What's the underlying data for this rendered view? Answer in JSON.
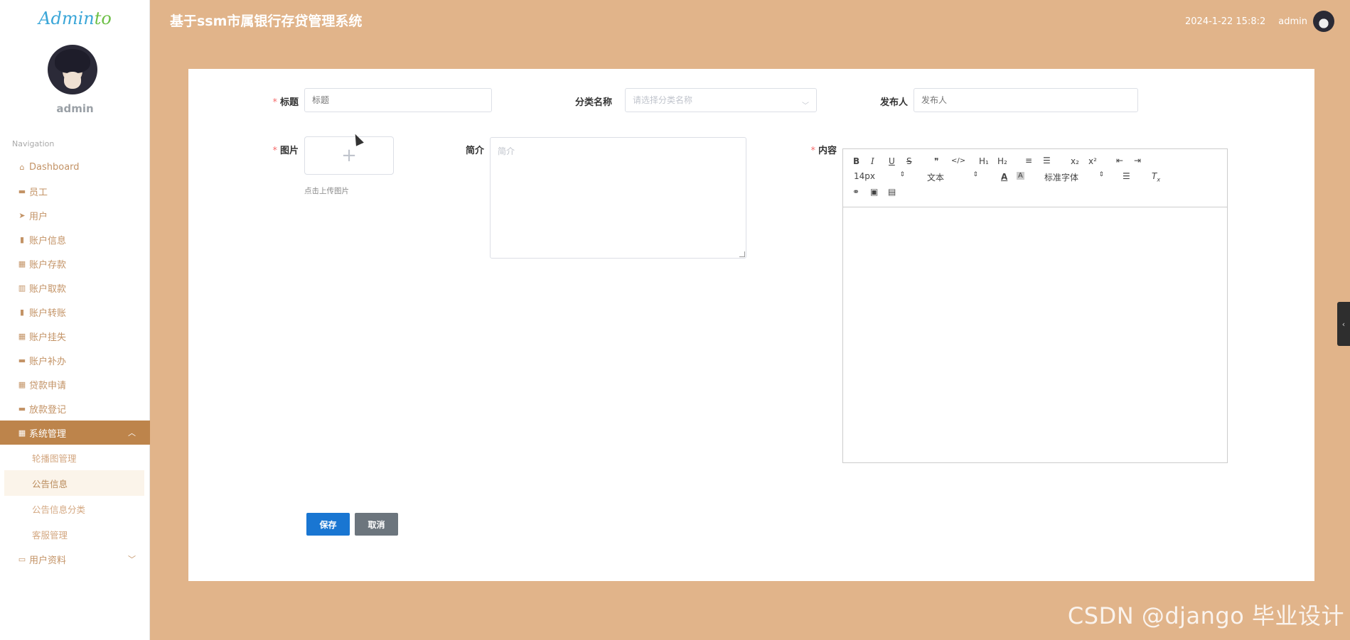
{
  "sidebar": {
    "logo_main": "Admin",
    "logo_accent": "to",
    "username": "admin",
    "nav_header": "Navigation",
    "items": [
      {
        "label": "Dashboard",
        "icon": "⌂"
      },
      {
        "label": "员工",
        "icon": "▬"
      },
      {
        "label": "用户",
        "icon": "➤"
      },
      {
        "label": "账户信息",
        "icon": "▮"
      },
      {
        "label": "账户存款",
        "icon": "▦"
      },
      {
        "label": "账户取款",
        "icon": "▥"
      },
      {
        "label": "账户转账",
        "icon": "▮"
      },
      {
        "label": "账户挂失",
        "icon": "▦"
      },
      {
        "label": "账户补办",
        "icon": "▬"
      },
      {
        "label": "贷款申请",
        "icon": "▦"
      },
      {
        "label": "放款登记",
        "icon": "▬"
      }
    ],
    "active_item": {
      "label": "系统管理",
      "icon": "▦",
      "chevron": "︿"
    },
    "subitems": [
      "轮播图管理",
      "公告信息",
      "公告信息分类",
      "客服管理"
    ],
    "last_item": {
      "label": "用户资料",
      "icon": "▭",
      "chevron": "﹀"
    }
  },
  "header": {
    "title": "基于ssm市属银行存贷管理系统",
    "datetime": "2024-1-22 15:8:2",
    "user": "admin"
  },
  "form": {
    "title_label": "标题",
    "title_placeholder": "标题",
    "category_label": "分类名称",
    "category_placeholder": "请选择分类名称",
    "publisher_label": "发布人",
    "publisher_placeholder": "发布人",
    "image_label": "图片",
    "upload_plus": "+",
    "upload_tip": "点击上传图片",
    "intro_label": "简介",
    "intro_placeholder": "简介",
    "content_label": "内容",
    "required_mark": "*",
    "save_label": "保存",
    "cancel_label": "取消"
  },
  "editor": {
    "font_size": "14px",
    "header_select": "文本",
    "font_family": "标准字体",
    "buttons": [
      "B",
      "I",
      "U",
      "S",
      "❞",
      "</>",
      "H₁",
      "H₂",
      "≡",
      "☰",
      "x₂",
      "x²",
      "⇤",
      "⇥"
    ]
  },
  "right_tab_icon": "‹",
  "watermark": "CSDN @django 毕业设计"
}
